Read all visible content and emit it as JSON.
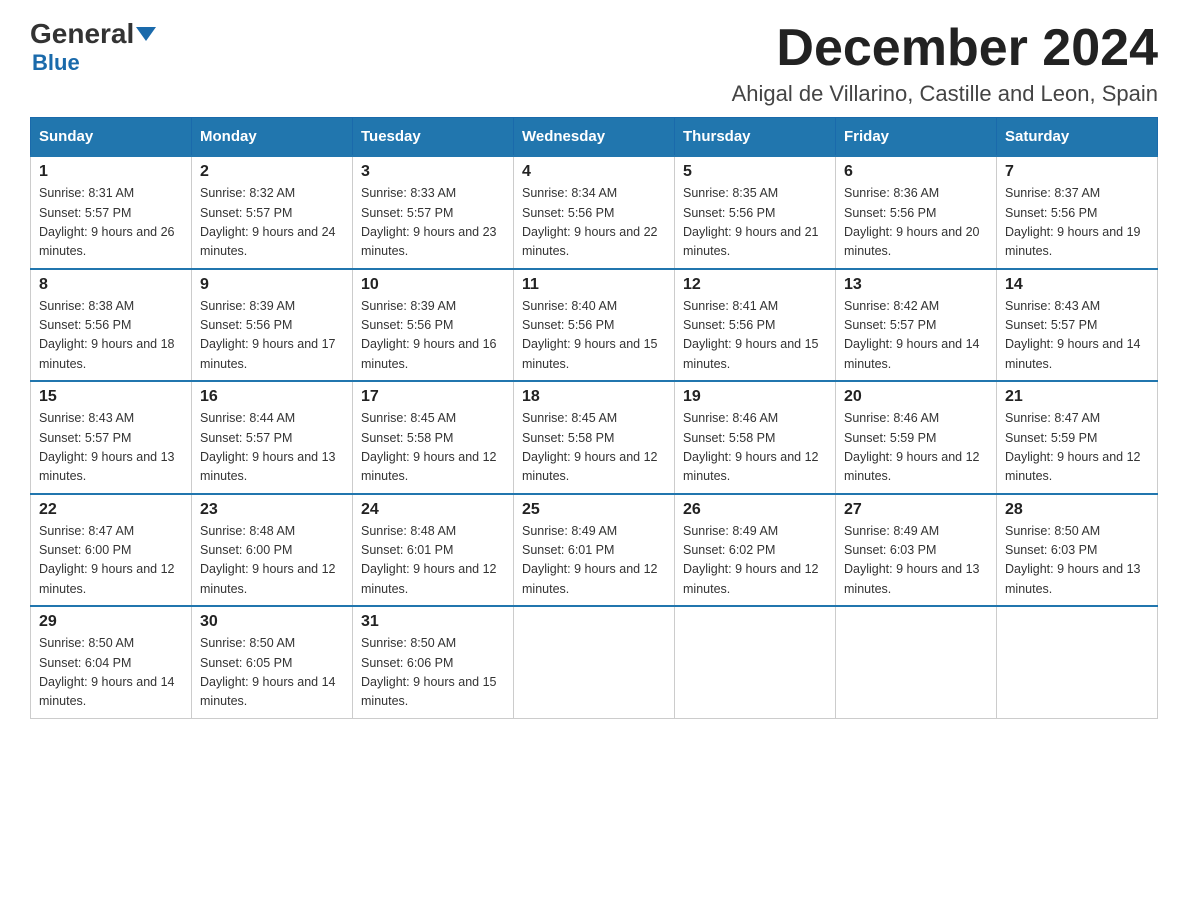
{
  "header": {
    "logo_general": "General",
    "logo_blue": "Blue",
    "month_title": "December 2024",
    "location": "Ahigal de Villarino, Castille and Leon, Spain"
  },
  "weekdays": [
    "Sunday",
    "Monday",
    "Tuesday",
    "Wednesday",
    "Thursday",
    "Friday",
    "Saturday"
  ],
  "weeks": [
    [
      {
        "day": "1",
        "sunrise": "8:31 AM",
        "sunset": "5:57 PM",
        "daylight": "9 hours and 26 minutes."
      },
      {
        "day": "2",
        "sunrise": "8:32 AM",
        "sunset": "5:57 PM",
        "daylight": "9 hours and 24 minutes."
      },
      {
        "day": "3",
        "sunrise": "8:33 AM",
        "sunset": "5:57 PM",
        "daylight": "9 hours and 23 minutes."
      },
      {
        "day": "4",
        "sunrise": "8:34 AM",
        "sunset": "5:56 PM",
        "daylight": "9 hours and 22 minutes."
      },
      {
        "day": "5",
        "sunrise": "8:35 AM",
        "sunset": "5:56 PM",
        "daylight": "9 hours and 21 minutes."
      },
      {
        "day": "6",
        "sunrise": "8:36 AM",
        "sunset": "5:56 PM",
        "daylight": "9 hours and 20 minutes."
      },
      {
        "day": "7",
        "sunrise": "8:37 AM",
        "sunset": "5:56 PM",
        "daylight": "9 hours and 19 minutes."
      }
    ],
    [
      {
        "day": "8",
        "sunrise": "8:38 AM",
        "sunset": "5:56 PM",
        "daylight": "9 hours and 18 minutes."
      },
      {
        "day": "9",
        "sunrise": "8:39 AM",
        "sunset": "5:56 PM",
        "daylight": "9 hours and 17 minutes."
      },
      {
        "day": "10",
        "sunrise": "8:39 AM",
        "sunset": "5:56 PM",
        "daylight": "9 hours and 16 minutes."
      },
      {
        "day": "11",
        "sunrise": "8:40 AM",
        "sunset": "5:56 PM",
        "daylight": "9 hours and 15 minutes."
      },
      {
        "day": "12",
        "sunrise": "8:41 AM",
        "sunset": "5:56 PM",
        "daylight": "9 hours and 15 minutes."
      },
      {
        "day": "13",
        "sunrise": "8:42 AM",
        "sunset": "5:57 PM",
        "daylight": "9 hours and 14 minutes."
      },
      {
        "day": "14",
        "sunrise": "8:43 AM",
        "sunset": "5:57 PM",
        "daylight": "9 hours and 14 minutes."
      }
    ],
    [
      {
        "day": "15",
        "sunrise": "8:43 AM",
        "sunset": "5:57 PM",
        "daylight": "9 hours and 13 minutes."
      },
      {
        "day": "16",
        "sunrise": "8:44 AM",
        "sunset": "5:57 PM",
        "daylight": "9 hours and 13 minutes."
      },
      {
        "day": "17",
        "sunrise": "8:45 AM",
        "sunset": "5:58 PM",
        "daylight": "9 hours and 12 minutes."
      },
      {
        "day": "18",
        "sunrise": "8:45 AM",
        "sunset": "5:58 PM",
        "daylight": "9 hours and 12 minutes."
      },
      {
        "day": "19",
        "sunrise": "8:46 AM",
        "sunset": "5:58 PM",
        "daylight": "9 hours and 12 minutes."
      },
      {
        "day": "20",
        "sunrise": "8:46 AM",
        "sunset": "5:59 PM",
        "daylight": "9 hours and 12 minutes."
      },
      {
        "day": "21",
        "sunrise": "8:47 AM",
        "sunset": "5:59 PM",
        "daylight": "9 hours and 12 minutes."
      }
    ],
    [
      {
        "day": "22",
        "sunrise": "8:47 AM",
        "sunset": "6:00 PM",
        "daylight": "9 hours and 12 minutes."
      },
      {
        "day": "23",
        "sunrise": "8:48 AM",
        "sunset": "6:00 PM",
        "daylight": "9 hours and 12 minutes."
      },
      {
        "day": "24",
        "sunrise": "8:48 AM",
        "sunset": "6:01 PM",
        "daylight": "9 hours and 12 minutes."
      },
      {
        "day": "25",
        "sunrise": "8:49 AM",
        "sunset": "6:01 PM",
        "daylight": "9 hours and 12 minutes."
      },
      {
        "day": "26",
        "sunrise": "8:49 AM",
        "sunset": "6:02 PM",
        "daylight": "9 hours and 12 minutes."
      },
      {
        "day": "27",
        "sunrise": "8:49 AM",
        "sunset": "6:03 PM",
        "daylight": "9 hours and 13 minutes."
      },
      {
        "day": "28",
        "sunrise": "8:50 AM",
        "sunset": "6:03 PM",
        "daylight": "9 hours and 13 minutes."
      }
    ],
    [
      {
        "day": "29",
        "sunrise": "8:50 AM",
        "sunset": "6:04 PM",
        "daylight": "9 hours and 14 minutes."
      },
      {
        "day": "30",
        "sunrise": "8:50 AM",
        "sunset": "6:05 PM",
        "daylight": "9 hours and 14 minutes."
      },
      {
        "day": "31",
        "sunrise": "8:50 AM",
        "sunset": "6:06 PM",
        "daylight": "9 hours and 15 minutes."
      },
      null,
      null,
      null,
      null
    ]
  ]
}
